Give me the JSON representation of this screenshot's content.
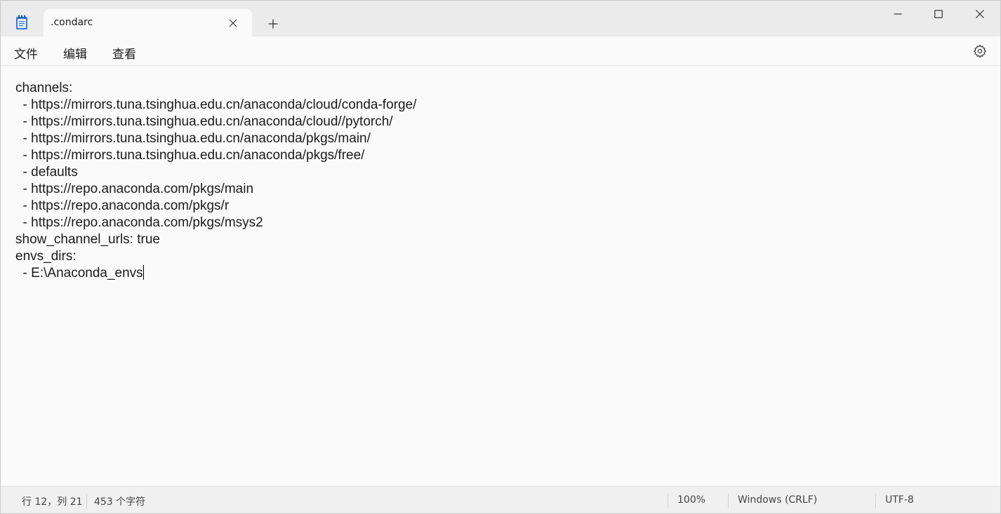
{
  "window": {
    "tab_title": ".condarc"
  },
  "menu": {
    "file": "文件",
    "edit": "编辑",
    "view": "查看"
  },
  "editor": {
    "lines": [
      "channels:",
      "  - https://mirrors.tuna.tsinghua.edu.cn/anaconda/cloud/conda-forge/",
      "  - https://mirrors.tuna.tsinghua.edu.cn/anaconda/cloud//pytorch/",
      "  - https://mirrors.tuna.tsinghua.edu.cn/anaconda/pkgs/main/",
      "  - https://mirrors.tuna.tsinghua.edu.cn/anaconda/pkgs/free/",
      "  - defaults",
      "  - https://repo.anaconda.com/pkgs/main",
      "  - https://repo.anaconda.com/pkgs/r",
      "  - https://repo.anaconda.com/pkgs/msys2",
      "show_channel_urls: true",
      "envs_dirs:",
      "  - E:\\Anaconda_envs"
    ]
  },
  "status": {
    "position": "行 12，列 21",
    "char_count": "453 个字符",
    "zoom": "100%",
    "line_ending": "Windows (CRLF)",
    "encoding": "UTF-8"
  },
  "icons": {
    "app": "notepad-icon",
    "tab_close": "close-icon",
    "new_tab": "plus-icon",
    "minimize": "minimize-icon",
    "maximize": "maximize-icon",
    "close": "close-icon",
    "settings": "gear-icon"
  },
  "colors": {
    "titlebar_bg": "#ebebeb",
    "editor_bg": "#fafafa",
    "statusbar_bg": "#f0f0f0",
    "app_icon_blue": "#3a7bd5"
  }
}
